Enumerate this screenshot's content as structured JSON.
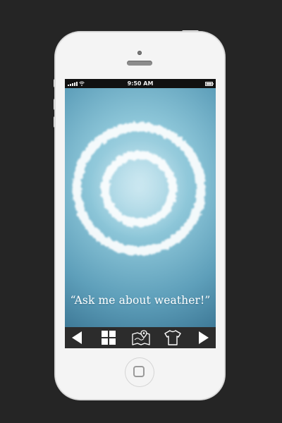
{
  "status_bar": {
    "time": "9:50 AM"
  },
  "weather": {
    "prompt": "“Ask me about weather!”"
  },
  "toolbar": {
    "items": [
      {
        "name": "back",
        "icon": "triangle-left-icon"
      },
      {
        "name": "home-grid",
        "icon": "grid-icon"
      },
      {
        "name": "map",
        "icon": "map-pin-icon"
      },
      {
        "name": "clothing",
        "icon": "tshirt-icon"
      },
      {
        "name": "forward",
        "icon": "triangle-right-icon"
      }
    ]
  },
  "colors": {
    "background": "#252525",
    "phone_body": "#f4f4f4",
    "screen_top": "#b7dde9",
    "screen_bottom": "#336a88",
    "toolbar": "#2c2c2c",
    "text": "#ffffff"
  }
}
